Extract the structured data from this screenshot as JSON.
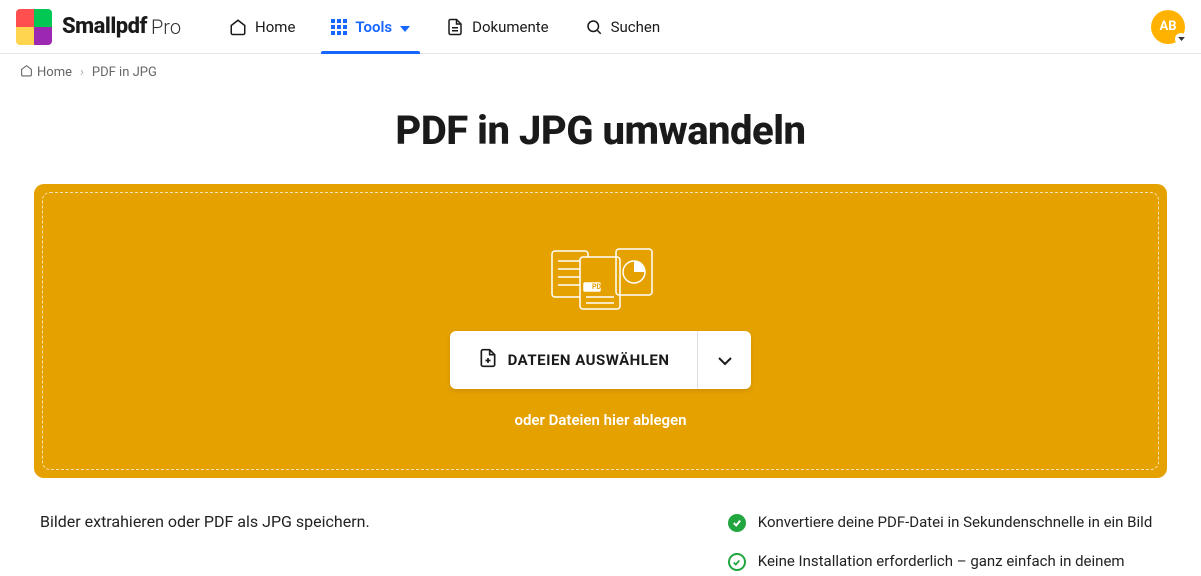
{
  "brand": {
    "name": "Smallpdf",
    "tier": "Pro"
  },
  "nav": {
    "home": "Home",
    "tools": "Tools",
    "documents": "Dokumente",
    "search": "Suchen"
  },
  "avatar": {
    "initials": "AB"
  },
  "breadcrumb": {
    "home": "Home",
    "current": "PDF in JPG"
  },
  "title": "PDF in JPG umwandeln",
  "dropzone": {
    "choose_label": "DATEIEN AUSWÄHLEN",
    "hint": "oder Dateien hier ablegen"
  },
  "sub_desc": "Bilder extrahieren oder PDF als JPG speichern.",
  "benefits": [
    "Konvertiere deine PDF-Datei in Sekundenschnelle in ein Bild",
    "Keine Installation erforderlich – ganz einfach in deinem"
  ],
  "colors": {
    "accent": "#1766ff",
    "drop_bg": "#e5a100",
    "avatar": "#ffb300",
    "success": "#22a63f"
  }
}
